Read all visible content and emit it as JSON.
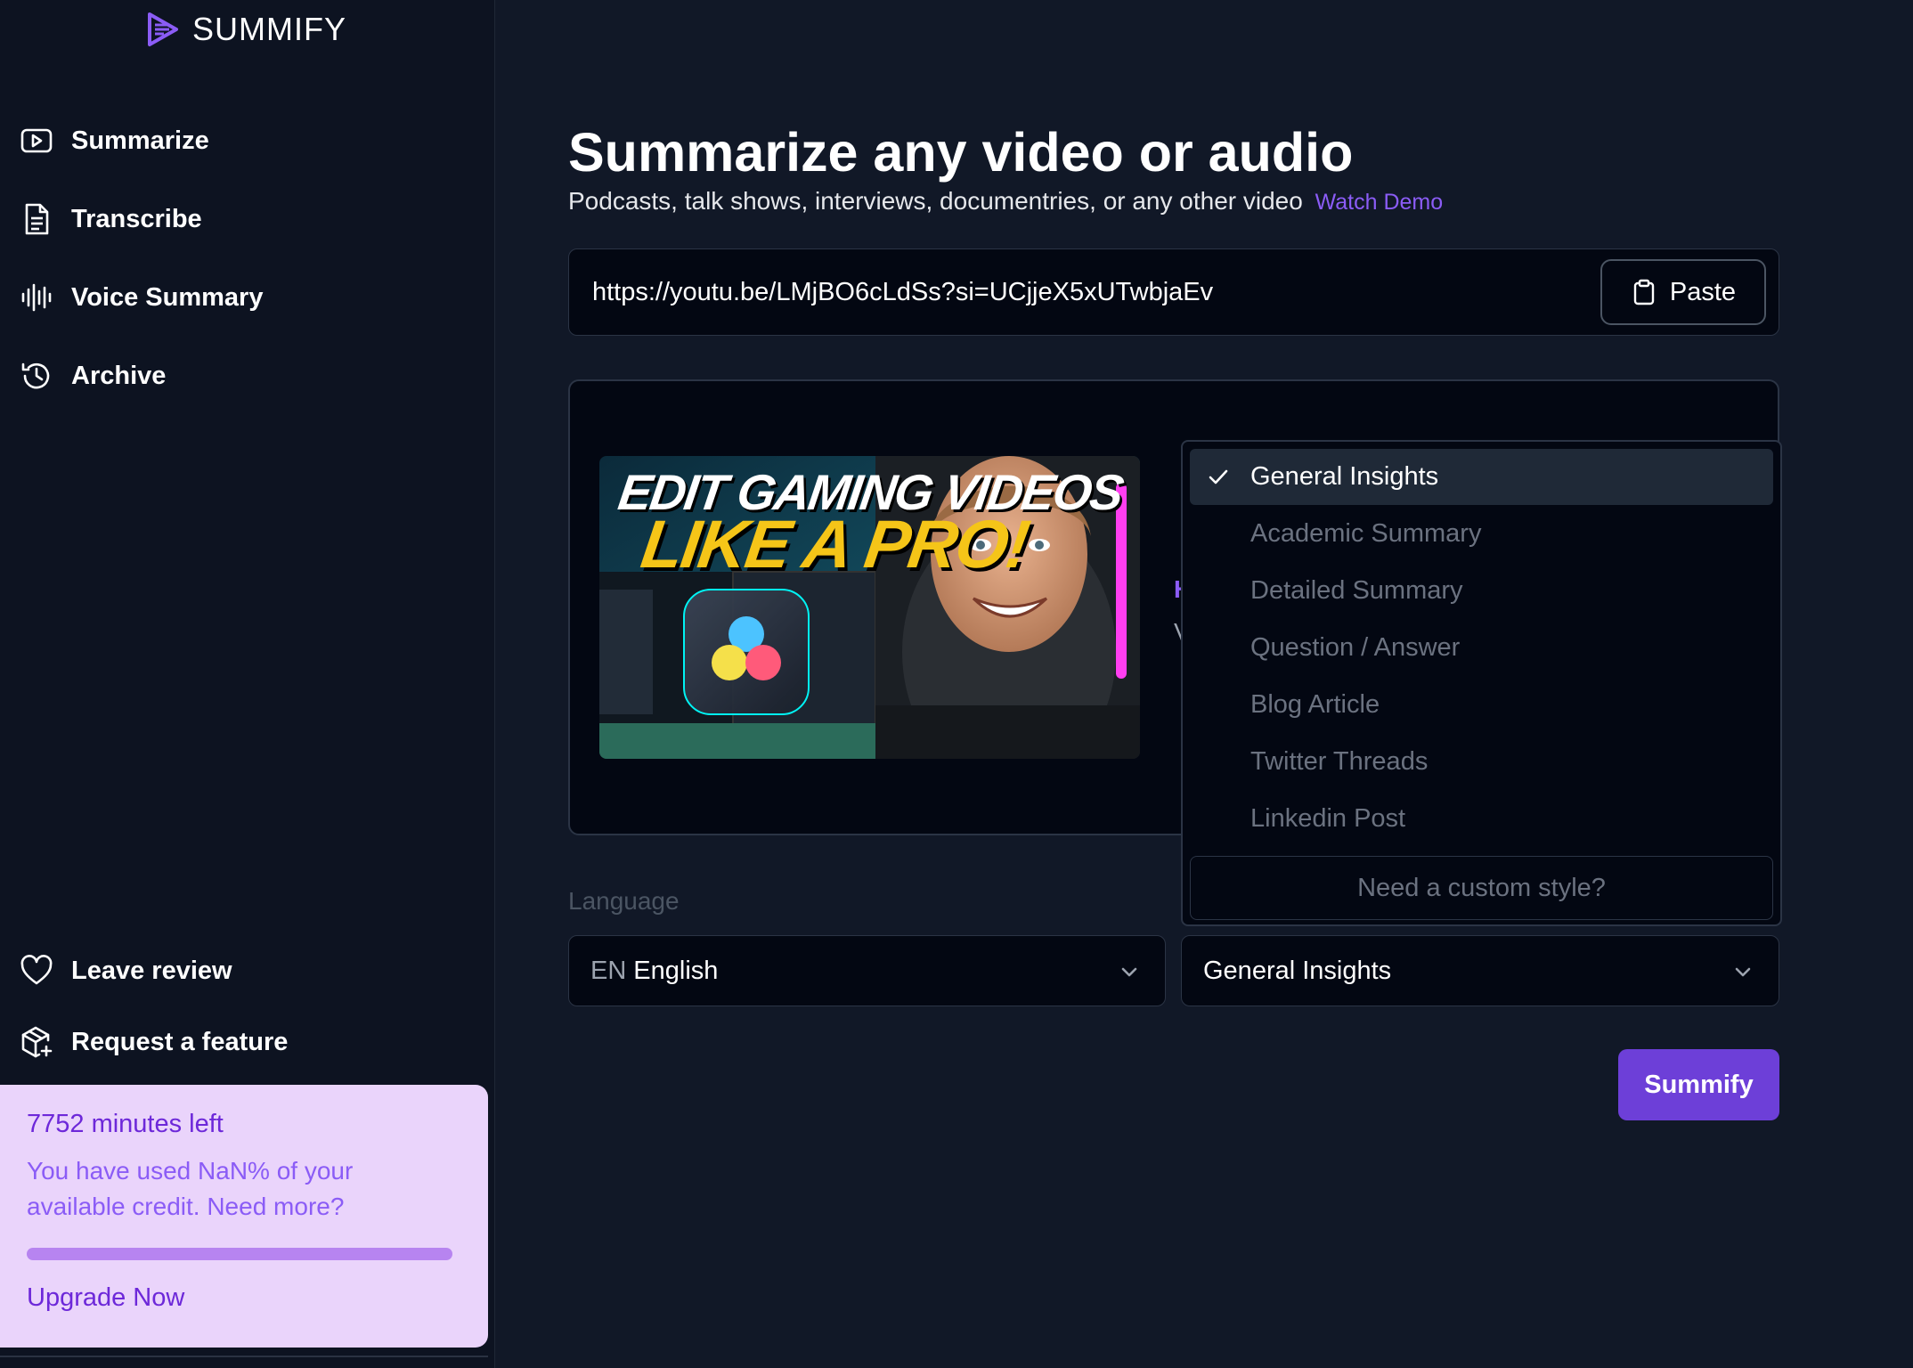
{
  "brand": {
    "name": "SUMMIFY",
    "accent": "#8b5cf6"
  },
  "sidebar": {
    "items": [
      {
        "label": "Summarize",
        "icon": "play-square-icon"
      },
      {
        "label": "Transcribe",
        "icon": "document-icon"
      },
      {
        "label": "Voice Summary",
        "icon": "audio-wave-icon"
      },
      {
        "label": "Archive",
        "icon": "history-icon"
      }
    ],
    "bottom_items": [
      {
        "label": "Leave review",
        "icon": "heart-icon"
      },
      {
        "label": "Request a feature",
        "icon": "package-plus-icon"
      }
    ],
    "credit": {
      "minutes_left": "7752 minutes left",
      "usage_text": "You have used NaN% of your available credit. Need more?",
      "progress_fraction": 1.0,
      "upgrade_label": "Upgrade Now"
    }
  },
  "main": {
    "title": "Summarize any video or audio",
    "subtitle": "Podcasts, talk shows, interviews, documentries, or any other video",
    "watch_demo": "Watch Demo",
    "url_value": "https://youtu.be/LMjBO6cLdSs?si=UCjjeX5xUTwbjaEv",
    "paste_label": "Paste",
    "thumbnail": {
      "line1": "EDIT GAMING VIDEOS",
      "line2": "LIKE A PRO!"
    },
    "peek_1": "H",
    "peek_2": "V",
    "language_label": "Language",
    "language": {
      "code": "EN",
      "name": "English"
    },
    "style_selected": "General Insights",
    "submit_label": "Summify"
  },
  "dropdown": {
    "options": [
      {
        "label": "General Insights",
        "selected": true
      },
      {
        "label": "Academic Summary",
        "selected": false
      },
      {
        "label": "Detailed Summary",
        "selected": false
      },
      {
        "label": "Question / Answer",
        "selected": false
      },
      {
        "label": "Blog Article",
        "selected": false
      },
      {
        "label": "Twitter Threads",
        "selected": false
      },
      {
        "label": "Linkedin Post",
        "selected": false
      }
    ],
    "custom_label": "Need a custom style?"
  }
}
